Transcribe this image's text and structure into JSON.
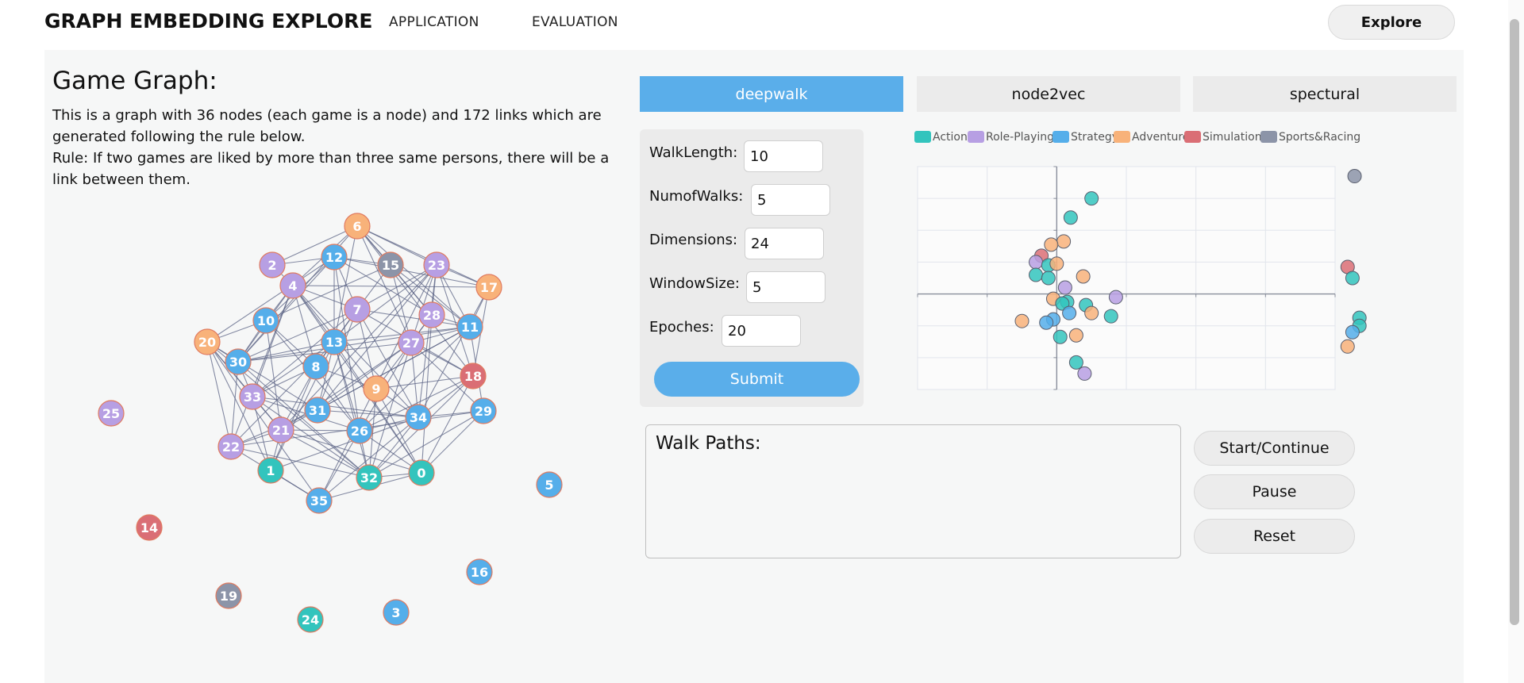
{
  "nav": {
    "brand": "GRAPH EMBEDDING EXPLORE",
    "links": [
      "APPLICATION",
      "EVALUATION"
    ],
    "explore_label": "Explore"
  },
  "graph_section": {
    "title": "Game Graph:",
    "description": "This is a graph with 36 nodes (each game is a node) and 172 links which are generated following the rule below.",
    "rule": "Rule: If two games are liked by more than three same persons, there will be a link between them."
  },
  "tabs": [
    "deepwalk",
    "node2vec",
    "spectural"
  ],
  "params": {
    "walk_length": {
      "label": "WalkLength:",
      "value": "10"
    },
    "num_walks": {
      "label": "NumofWalks:",
      "value": "5"
    },
    "dimensions": {
      "label": "Dimensions:",
      "value": "24"
    },
    "window_size": {
      "label": "WindowSize:",
      "value": "5"
    },
    "epoches": {
      "label": "Epoches:",
      "value": "20"
    },
    "submit_label": "Submit"
  },
  "walk_paths": {
    "title": "Walk Paths:"
  },
  "controls": {
    "start": "Start/Continue",
    "pause": "Pause",
    "reset": "Reset"
  },
  "colors": {
    "action": "#33c4bd",
    "role_playing": "#b79fe3",
    "strategy": "#55aeea",
    "adventure": "#f8b27a",
    "simulation": "#da6e75",
    "sports_racing": "#8c94a8",
    "accent": "#5aaeea"
  },
  "graph_nodes": [
    {
      "id": "6",
      "cat": "adventure"
    },
    {
      "id": "2",
      "cat": "role_playing"
    },
    {
      "id": "12",
      "cat": "strategy"
    },
    {
      "id": "15",
      "cat": "sports_racing"
    },
    {
      "id": "23",
      "cat": "role_playing"
    },
    {
      "id": "4",
      "cat": "role_playing"
    },
    {
      "id": "17",
      "cat": "adventure"
    },
    {
      "id": "10",
      "cat": "strategy"
    },
    {
      "id": "7",
      "cat": "role_playing"
    },
    {
      "id": "28",
      "cat": "role_playing"
    },
    {
      "id": "11",
      "cat": "strategy"
    },
    {
      "id": "20",
      "cat": "adventure"
    },
    {
      "id": "13",
      "cat": "strategy"
    },
    {
      "id": "27",
      "cat": "role_playing"
    },
    {
      "id": "30",
      "cat": "strategy"
    },
    {
      "id": "8",
      "cat": "strategy"
    },
    {
      "id": "18",
      "cat": "simulation"
    },
    {
      "id": "9",
      "cat": "adventure"
    },
    {
      "id": "33",
      "cat": "role_playing"
    },
    {
      "id": "25",
      "cat": "role_playing"
    },
    {
      "id": "31",
      "cat": "strategy"
    },
    {
      "id": "34",
      "cat": "strategy"
    },
    {
      "id": "29",
      "cat": "strategy"
    },
    {
      "id": "21",
      "cat": "role_playing"
    },
    {
      "id": "26",
      "cat": "strategy"
    },
    {
      "id": "22",
      "cat": "role_playing"
    },
    {
      "id": "1",
      "cat": "action"
    },
    {
      "id": "32",
      "cat": "action"
    },
    {
      "id": "0",
      "cat": "action"
    },
    {
      "id": "5",
      "cat": "strategy"
    },
    {
      "id": "35",
      "cat": "strategy"
    },
    {
      "id": "14",
      "cat": "simulation"
    },
    {
      "id": "16",
      "cat": "strategy"
    },
    {
      "id": "19",
      "cat": "sports_racing"
    },
    {
      "id": "3",
      "cat": "strategy"
    },
    {
      "id": "24",
      "cat": "action"
    }
  ],
  "chart_data": {
    "type": "scatter",
    "legend": [
      "Action",
      "Role-Playing",
      "Strategy",
      "Adventure",
      "Simulation",
      "Sports&Racing"
    ],
    "legend_keys": [
      "action",
      "role_playing",
      "strategy",
      "adventure",
      "simulation",
      "sports_racing"
    ],
    "legend_position": "top",
    "grid": true,
    "xlim": [
      -2,
      4
    ],
    "ylim": [
      -3,
      4
    ],
    "points": [
      {
        "x": 4.28,
        "y": 3.7,
        "cat": "sports_racing"
      },
      {
        "x": 0.5,
        "y": 3.0,
        "cat": "action"
      },
      {
        "x": 0.2,
        "y": 2.4,
        "cat": "action"
      },
      {
        "x": 0.1,
        "y": 1.65,
        "cat": "adventure"
      },
      {
        "x": -0.08,
        "y": 1.55,
        "cat": "adventure"
      },
      {
        "x": -0.22,
        "y": 1.2,
        "cat": "simulation"
      },
      {
        "x": -0.3,
        "y": 1.0,
        "cat": "role_playing"
      },
      {
        "x": -0.12,
        "y": 0.9,
        "cat": "action"
      },
      {
        "x": 0.0,
        "y": 0.95,
        "cat": "adventure"
      },
      {
        "x": -0.3,
        "y": 0.6,
        "cat": "action"
      },
      {
        "x": -0.12,
        "y": 0.5,
        "cat": "action"
      },
      {
        "x": 0.38,
        "y": 0.55,
        "cat": "adventure"
      },
      {
        "x": 0.12,
        "y": 0.2,
        "cat": "role_playing"
      },
      {
        "x": 0.85,
        "y": -0.1,
        "cat": "role_playing"
      },
      {
        "x": -0.05,
        "y": -0.15,
        "cat": "adventure"
      },
      {
        "x": 0.15,
        "y": -0.25,
        "cat": "action"
      },
      {
        "x": 0.08,
        "y": -0.3,
        "cat": "action"
      },
      {
        "x": 0.42,
        "y": -0.35,
        "cat": "action"
      },
      {
        "x": 0.5,
        "y": -0.6,
        "cat": "adventure"
      },
      {
        "x": 0.78,
        "y": -0.7,
        "cat": "action"
      },
      {
        "x": 0.18,
        "y": -0.6,
        "cat": "strategy"
      },
      {
        "x": -0.05,
        "y": -0.8,
        "cat": "strategy"
      },
      {
        "x": -0.5,
        "y": -0.85,
        "cat": "adventure"
      },
      {
        "x": -0.15,
        "y": -0.9,
        "cat": "strategy"
      },
      {
        "x": 0.28,
        "y": -1.3,
        "cat": "adventure"
      },
      {
        "x": 0.05,
        "y": -1.35,
        "cat": "action"
      },
      {
        "x": 0.28,
        "y": -2.15,
        "cat": "action"
      },
      {
        "x": 0.4,
        "y": -2.5,
        "cat": "role_playing"
      },
      {
        "x": 4.18,
        "y": 0.85,
        "cat": "simulation"
      },
      {
        "x": 4.25,
        "y": 0.5,
        "cat": "action"
      },
      {
        "x": 4.35,
        "y": -0.75,
        "cat": "action"
      },
      {
        "x": 4.35,
        "y": -1.0,
        "cat": "action"
      },
      {
        "x": 4.25,
        "y": -1.2,
        "cat": "strategy"
      },
      {
        "x": 4.18,
        "y": -1.65,
        "cat": "adventure"
      }
    ]
  }
}
